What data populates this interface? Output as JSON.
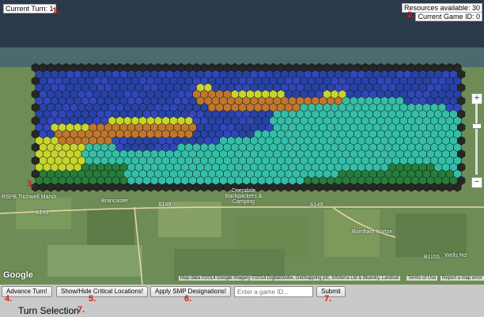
{
  "status": {
    "turn_label": "Current Turn: 1",
    "resources_label": "Resources available: 30",
    "game_id_label": "Current Game ID: 0"
  },
  "markers": {
    "m1": "1.",
    "m2": "2.",
    "m3": "3.",
    "m4": "4.",
    "m5": "5.",
    "m6": "6.",
    "m7a": "7.",
    "m7b": "7."
  },
  "map": {
    "zoom_in": "+",
    "zoom_out": "−",
    "logo": "Google",
    "attribution": "Map data ©2014 Google Imagery ©2014 DigitalGlobe, Getmapping plc, Infoterra Ltd & Bluesky, Landsat",
    "terms": "Terms of Use",
    "report": "Report a map error",
    "labels": {
      "tichwell": "RSPB Titchwell Marsh",
      "brancaster": "Brancaster",
      "deepdale": "Deepdale Backpackers & Camping",
      "a149_1": "A149",
      "a149_2": "A149",
      "a149_3": "A149",
      "wells": "Wells Rd",
      "b1155": "B1155",
      "burnham": "Burnham Norton"
    },
    "colors": {
      "sea": "#1f3bb0",
      "deep_sea": "#2a3fc7",
      "sand": "#d2dc2a",
      "orange": "#c8742a",
      "teal": "#2ec3b0",
      "green": "#1f7a3a",
      "dark_rim": "#1e1e1e"
    }
  },
  "controls": {
    "advance": "Advance Turn!",
    "toggle_critical": "Show/Hide Critical Locations!",
    "apply_smp": "Apply SMP Designations!",
    "game_id_placeholder": "Enter a game ID...",
    "submit": "Submit"
  },
  "section_title": "Turn Selection"
}
